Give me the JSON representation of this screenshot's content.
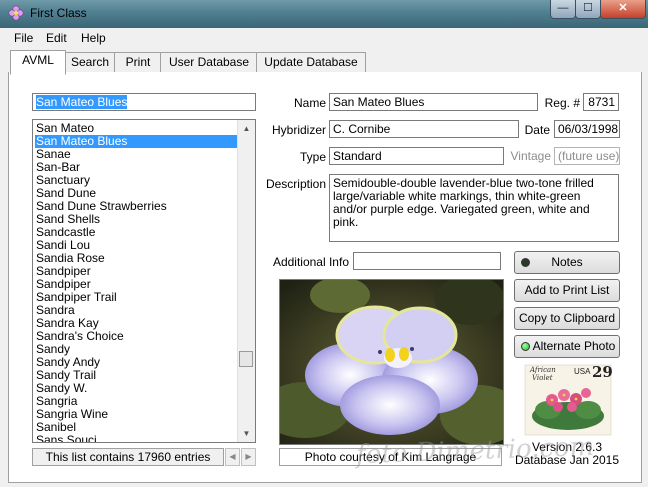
{
  "window": {
    "title": "First Class",
    "minimize": "—",
    "maximize": "☐",
    "close": "✕"
  },
  "menu": {
    "file": "File",
    "edit": "Edit",
    "help": "Help"
  },
  "tabs": [
    "AVML",
    "Search",
    "Print",
    "User Database",
    "Update Database"
  ],
  "search": {
    "value": "San Mateo Blues"
  },
  "list": {
    "items": [
      "San Mateo",
      "San Mateo Blues",
      "Sanae",
      "San-Bar",
      "Sanctuary",
      "Sand Dune",
      "Sand Dune Strawberries",
      "Sand Shells",
      "Sandcastle",
      "Sandi Lou",
      "Sandia Rose",
      "Sandpiper",
      "Sandpiper",
      "Sandpiper Trail",
      "Sandra",
      "Sandra Kay",
      "Sandra's Choice",
      "Sandy",
      "Sandy Andy",
      "Sandy Trail",
      "Sandy W.",
      "Sangria",
      "Sangria Wine",
      "Sanibel",
      "Sans Souci"
    ],
    "selected_index": 1,
    "status": "This list contains 17960 entries"
  },
  "record": {
    "name_label": "Name",
    "name": "San Mateo Blues",
    "reg_label": "Reg. #",
    "reg": "8731",
    "hybridizer_label": "Hybridizer",
    "hybridizer": "C. Cornibe",
    "date_label": "Date",
    "date": "06/03/1998",
    "type_label": "Type",
    "type": "Standard",
    "vintage_label": "Vintage",
    "vintage": "(future use)",
    "description_label": "Description",
    "description": "Semidouble-double lavender-blue two-tone frilled large/variable white markings, thin white-green and/or purple edge. Variegated green, white and pink.",
    "additional_label": "Additional Info",
    "additional": ""
  },
  "buttons": {
    "notes": "Notes",
    "add_print": "Add to Print List",
    "copy": "Copy to Clipboard",
    "alt_photo": "Alternate Photo"
  },
  "photo_caption": "Photo courtesy of Kim Langrage",
  "stamp": {
    "text1": "African",
    "text2": "Violet",
    "usa": "USA",
    "value": "29"
  },
  "version": {
    "line1": "Version 2.6.3",
    "line2": "Database Jan 2015"
  },
  "watermark": "foto Dimetrio.com"
}
